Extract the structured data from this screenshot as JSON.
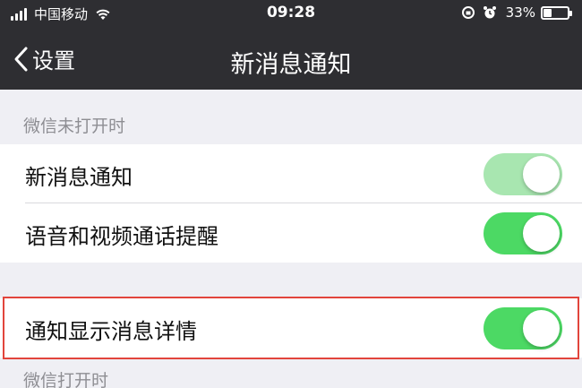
{
  "status_bar": {
    "carrier": "中国移动",
    "time": "09:28",
    "battery_percent": "33%",
    "battery_level": 0.33,
    "icons": [
      "signal-icon",
      "wifi-icon",
      "lock-rotation-icon",
      "alarm-icon",
      "battery-icon"
    ]
  },
  "nav": {
    "back_label": "设置",
    "title": "新消息通知"
  },
  "sections": [
    {
      "header": "微信未打开时",
      "rows": [
        {
          "label": "新消息通知",
          "on": true,
          "dimmed": true
        },
        {
          "label": "语音和视频通话提醒",
          "on": true,
          "dimmed": false
        }
      ]
    },
    {
      "header": "",
      "rows": [
        {
          "label": "通知显示消息详情",
          "on": true,
          "dimmed": false,
          "highlighted": true
        }
      ]
    },
    {
      "header": "微信打开时",
      "rows": []
    }
  ],
  "colors": {
    "nav_background": "#2e2e32",
    "page_background": "#efeff4",
    "toggle_on": "#4cd964",
    "toggle_on_dimmed": "#a8e6b0",
    "highlight_border": "#e2453c"
  }
}
